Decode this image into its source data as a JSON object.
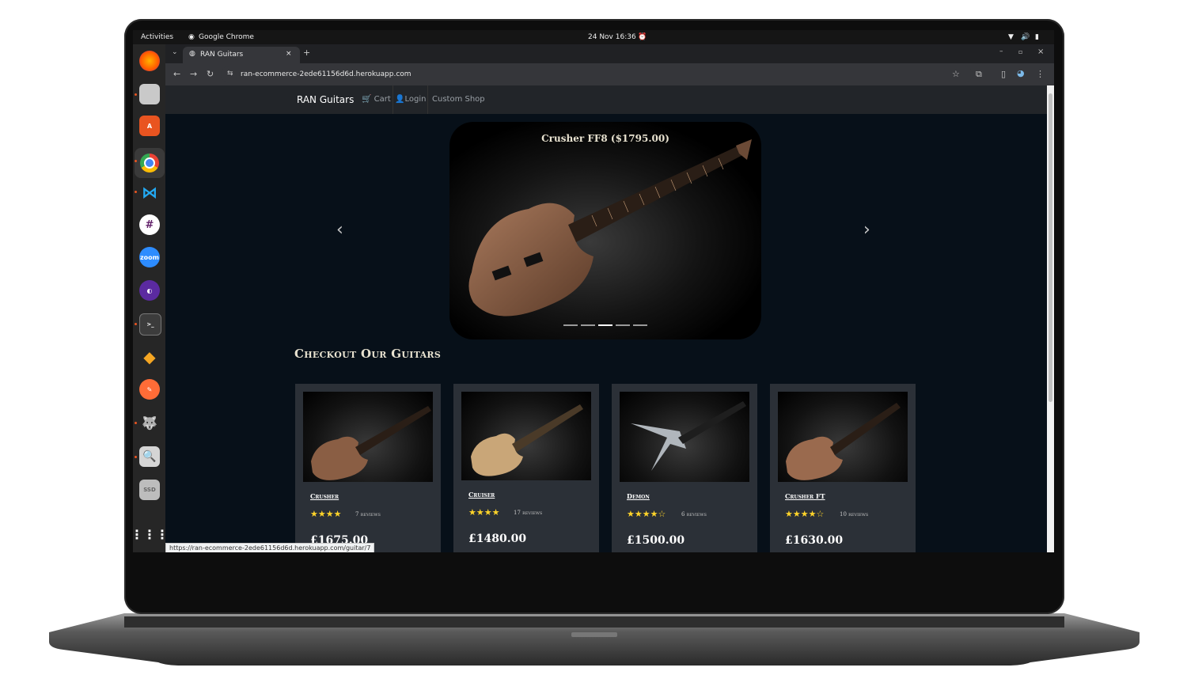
{
  "os": {
    "activities_label": "Activities",
    "app_name": "Google Chrome",
    "datetime": "24 Nov  16:36",
    "dock_apps": [
      "firefox-icon",
      "files-icon",
      "app-center-icon",
      "chrome-icon",
      "vscode-icon",
      "slack-icon",
      "zoom-icon",
      "tor-browser-icon",
      "terminal-icon",
      "dbeaver-icon",
      "postman-icon",
      "gimp-icon",
      "search-icon",
      "ssd-icon",
      "app-grid-icon"
    ],
    "zoom_label": "zoom",
    "ssd_label": "SSD"
  },
  "browser": {
    "tab_title": "RAN Guitars",
    "url": "ran-ecommerce-2ede61156d6d.herokuapp.com",
    "status_url": "https://ran-ecommerce-2ede61156d6d.herokuapp.com/guitar/7"
  },
  "site": {
    "brand": "RAN Guitars",
    "nav": {
      "cart": "Cart",
      "login": "Login",
      "custom_shop": "Custom Shop"
    },
    "carousel": {
      "caption": "Crusher FF8 ($1795.00)",
      "slide_count": 5,
      "active_index": 2
    },
    "section_heading": "Checkout Our Guitars",
    "products": [
      {
        "name": "Crusher",
        "stars": "★★★★",
        "reviews": "7 reviews",
        "price": "£1675.00"
      },
      {
        "name": "Cruiser",
        "stars": "★★★★",
        "reviews": "17 reviews",
        "price": "£1480.00"
      },
      {
        "name": "Demon",
        "stars": "★★★★☆",
        "reviews": "6 reviews",
        "price": "£1500.00"
      },
      {
        "name": "Crusher FT",
        "stars": "★★★★☆",
        "reviews": "10 reviews",
        "price": "£1630.00"
      }
    ]
  },
  "colors": {
    "page_bg": "#071019",
    "navbar_bg": "#222529",
    "card_bg": "#2b3037",
    "star": "#ffd42a",
    "accent": "#e95420"
  }
}
